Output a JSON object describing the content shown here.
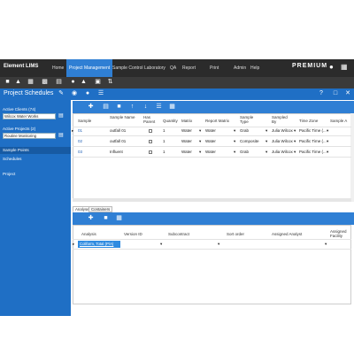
{
  "app": {
    "brand": "Element LIMS",
    "premium": "PREMIUM"
  },
  "nav": [
    "Home",
    "Project Management",
    "Sample Control",
    "Laboratory",
    "QA",
    "Report",
    "Print",
    "Admin",
    "Help"
  ],
  "page": {
    "title": "Project Schedules"
  },
  "sidebar": {
    "clients_label": "Active Clients (74)",
    "clients_value": "Wilcox Water Works",
    "projects_label": "Active Projects (2)",
    "projects_value": "Routine Monitoring",
    "items": [
      "Sample Points",
      "Schedules",
      "Project"
    ]
  },
  "grid": {
    "columns": [
      "Sample",
      "Sample Name",
      "Has Parent",
      "Quantity",
      "Matrix",
      "Report Matrix",
      "Sample Type",
      "Sampled By",
      "Time Zone",
      "Sample A"
    ],
    "rows": [
      {
        "sample": "01",
        "name": "outfall 01",
        "qty": "1",
        "matrix": "Water",
        "report_matrix": "Water",
        "type": "Grab",
        "by": "Julia Wilcox",
        "tz": "Pacific Time (..."
      },
      {
        "sample": "02",
        "name": "outfall 01",
        "qty": "1",
        "matrix": "Water",
        "report_matrix": "Water",
        "type": "Composite",
        "by": "Julia Wilcox",
        "tz": "Pacific Time (..."
      },
      {
        "sample": "03",
        "name": "Influent",
        "qty": "1",
        "matrix": "Water",
        "report_matrix": "Water",
        "type": "Grab",
        "by": "Julia Wilcox",
        "tz": "Pacific Time (..."
      }
    ]
  },
  "lower": {
    "tabs": [
      "Analyses",
      "Containers"
    ],
    "columns": [
      "Analysis",
      "Version ID",
      "Subcontract",
      "Sort order",
      "Assigned Analyst",
      "Assigned Facility"
    ],
    "row": {
      "analysis": "Coliform, Total (P/A)"
    }
  }
}
